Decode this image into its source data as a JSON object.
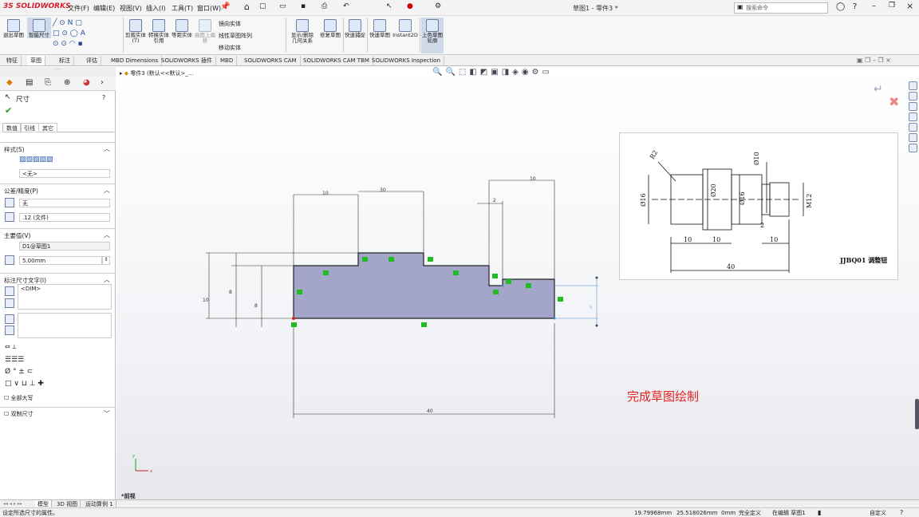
{
  "app": {
    "logo": "3S SOLIDWORKS",
    "title": "草图1 - 零件3 *"
  },
  "menu": [
    "文件(F)",
    "编辑(E)",
    "视图(V)",
    "插入(I)",
    "工具(T)",
    "窗口(W)"
  ],
  "search": {
    "placeholder": "搜索命令"
  },
  "ribbon": {
    "buttons": [
      "退出草图",
      "智能尺寸",
      "剪裁实体(T)",
      "转换实体引用",
      "等距实体",
      "曲面上偏移",
      "显示/删除几何关系",
      "修复草图",
      "快速捕捉",
      "快速草图",
      "Instant2D",
      "上色草图轮廓"
    ],
    "small": [
      "镜向实体",
      "线性草图阵列",
      "移动实体"
    ]
  },
  "tabs": [
    "特征",
    "草图",
    "标注",
    "评估",
    "MBD Dimensions",
    "SOLIDWORKS 插件",
    "MBD",
    "SOLIDWORKS CAM",
    "SOLIDWORKS CAM TBM",
    "SOLIDWORKS Inspection"
  ],
  "active_tab": "草图",
  "panel": {
    "title": "尺寸",
    "subtabs": [
      "数值",
      "引线",
      "其它"
    ],
    "style_label": "样式(S)",
    "style_value": "<无>",
    "tolerance_label": "公差/精度(P)",
    "tolerance_value": "无",
    "precision_value": ".12 (文件)",
    "primary_label": "主要值(V)",
    "primary_name": "D1@草图1",
    "primary_value": "5.00mm",
    "dimtext_label": "标注尺寸文字(I)",
    "dimtext_value": "<DIM>",
    "all_caps": "全部大写",
    "dual_label": "双制尺寸"
  },
  "breadcrumb": "零件3 (默认<<默认>_...",
  "drawing_dims": [
    "10",
    "30",
    "2",
    "10",
    "10",
    "8",
    "8",
    "5",
    "40"
  ],
  "note": {
    "dims": [
      "R2",
      "Ø16",
      "Ø20",
      "Ø16",
      "Ø10",
      "M12",
      "10",
      "10",
      "10",
      "2",
      "40"
    ],
    "caption": "JJBQ01 调整钮"
  },
  "finish_text": "完成草图绘制",
  "view_label": "*前视",
  "bottom_tabs": [
    "模型",
    "3D 视图",
    "运动算例 1"
  ],
  "status": {
    "left": "设定所选尺寸的属性。",
    "x": "19.79968mm",
    "y": "25.518026mm",
    "z": "0mm",
    "def": "完全定义",
    "editing": "在编辑 草图1",
    "units": "自定义"
  },
  "colors": {
    "accent": "#d1202f",
    "profile_fill": "#a3a6c9",
    "relation": "#22bb22",
    "text_red": "#e02020"
  }
}
